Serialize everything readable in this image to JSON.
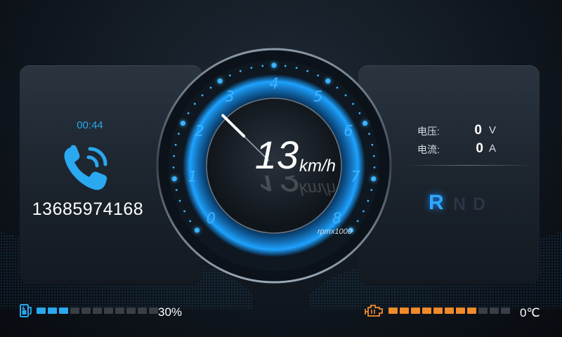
{
  "call": {
    "duration": "00:44",
    "number": "13685974168"
  },
  "speed": {
    "value": "13",
    "unit": "km/h"
  },
  "tachometer": {
    "labels": [
      "0",
      "1",
      "2",
      "3",
      "4",
      "5",
      "6",
      "7",
      "8"
    ],
    "scale_label": "rpmx1000",
    "needle_value": 2.6
  },
  "electrical": {
    "voltage": {
      "label": "电压:",
      "value": "0",
      "unit": "V"
    },
    "current": {
      "label": "电流:",
      "value": "0",
      "unit": "A"
    }
  },
  "gears": {
    "items": [
      "R",
      "N",
      "D"
    ],
    "active": "R"
  },
  "battery": {
    "percent_text": "30%",
    "segments_total": 11,
    "segments_lit": 3,
    "color": "#2aa8f0"
  },
  "temperature": {
    "value_text": "0℃",
    "segments_total": 11,
    "segments_lit": 8,
    "color": "#f08a2a"
  },
  "colors": {
    "accent": "#2aa8e8",
    "background": "#0a0e14",
    "tick_blue": "#3ab4ff"
  },
  "icons": {
    "phone": "phone-icon",
    "battery": "battery-charging-icon",
    "engine": "engine-temperature-icon"
  }
}
